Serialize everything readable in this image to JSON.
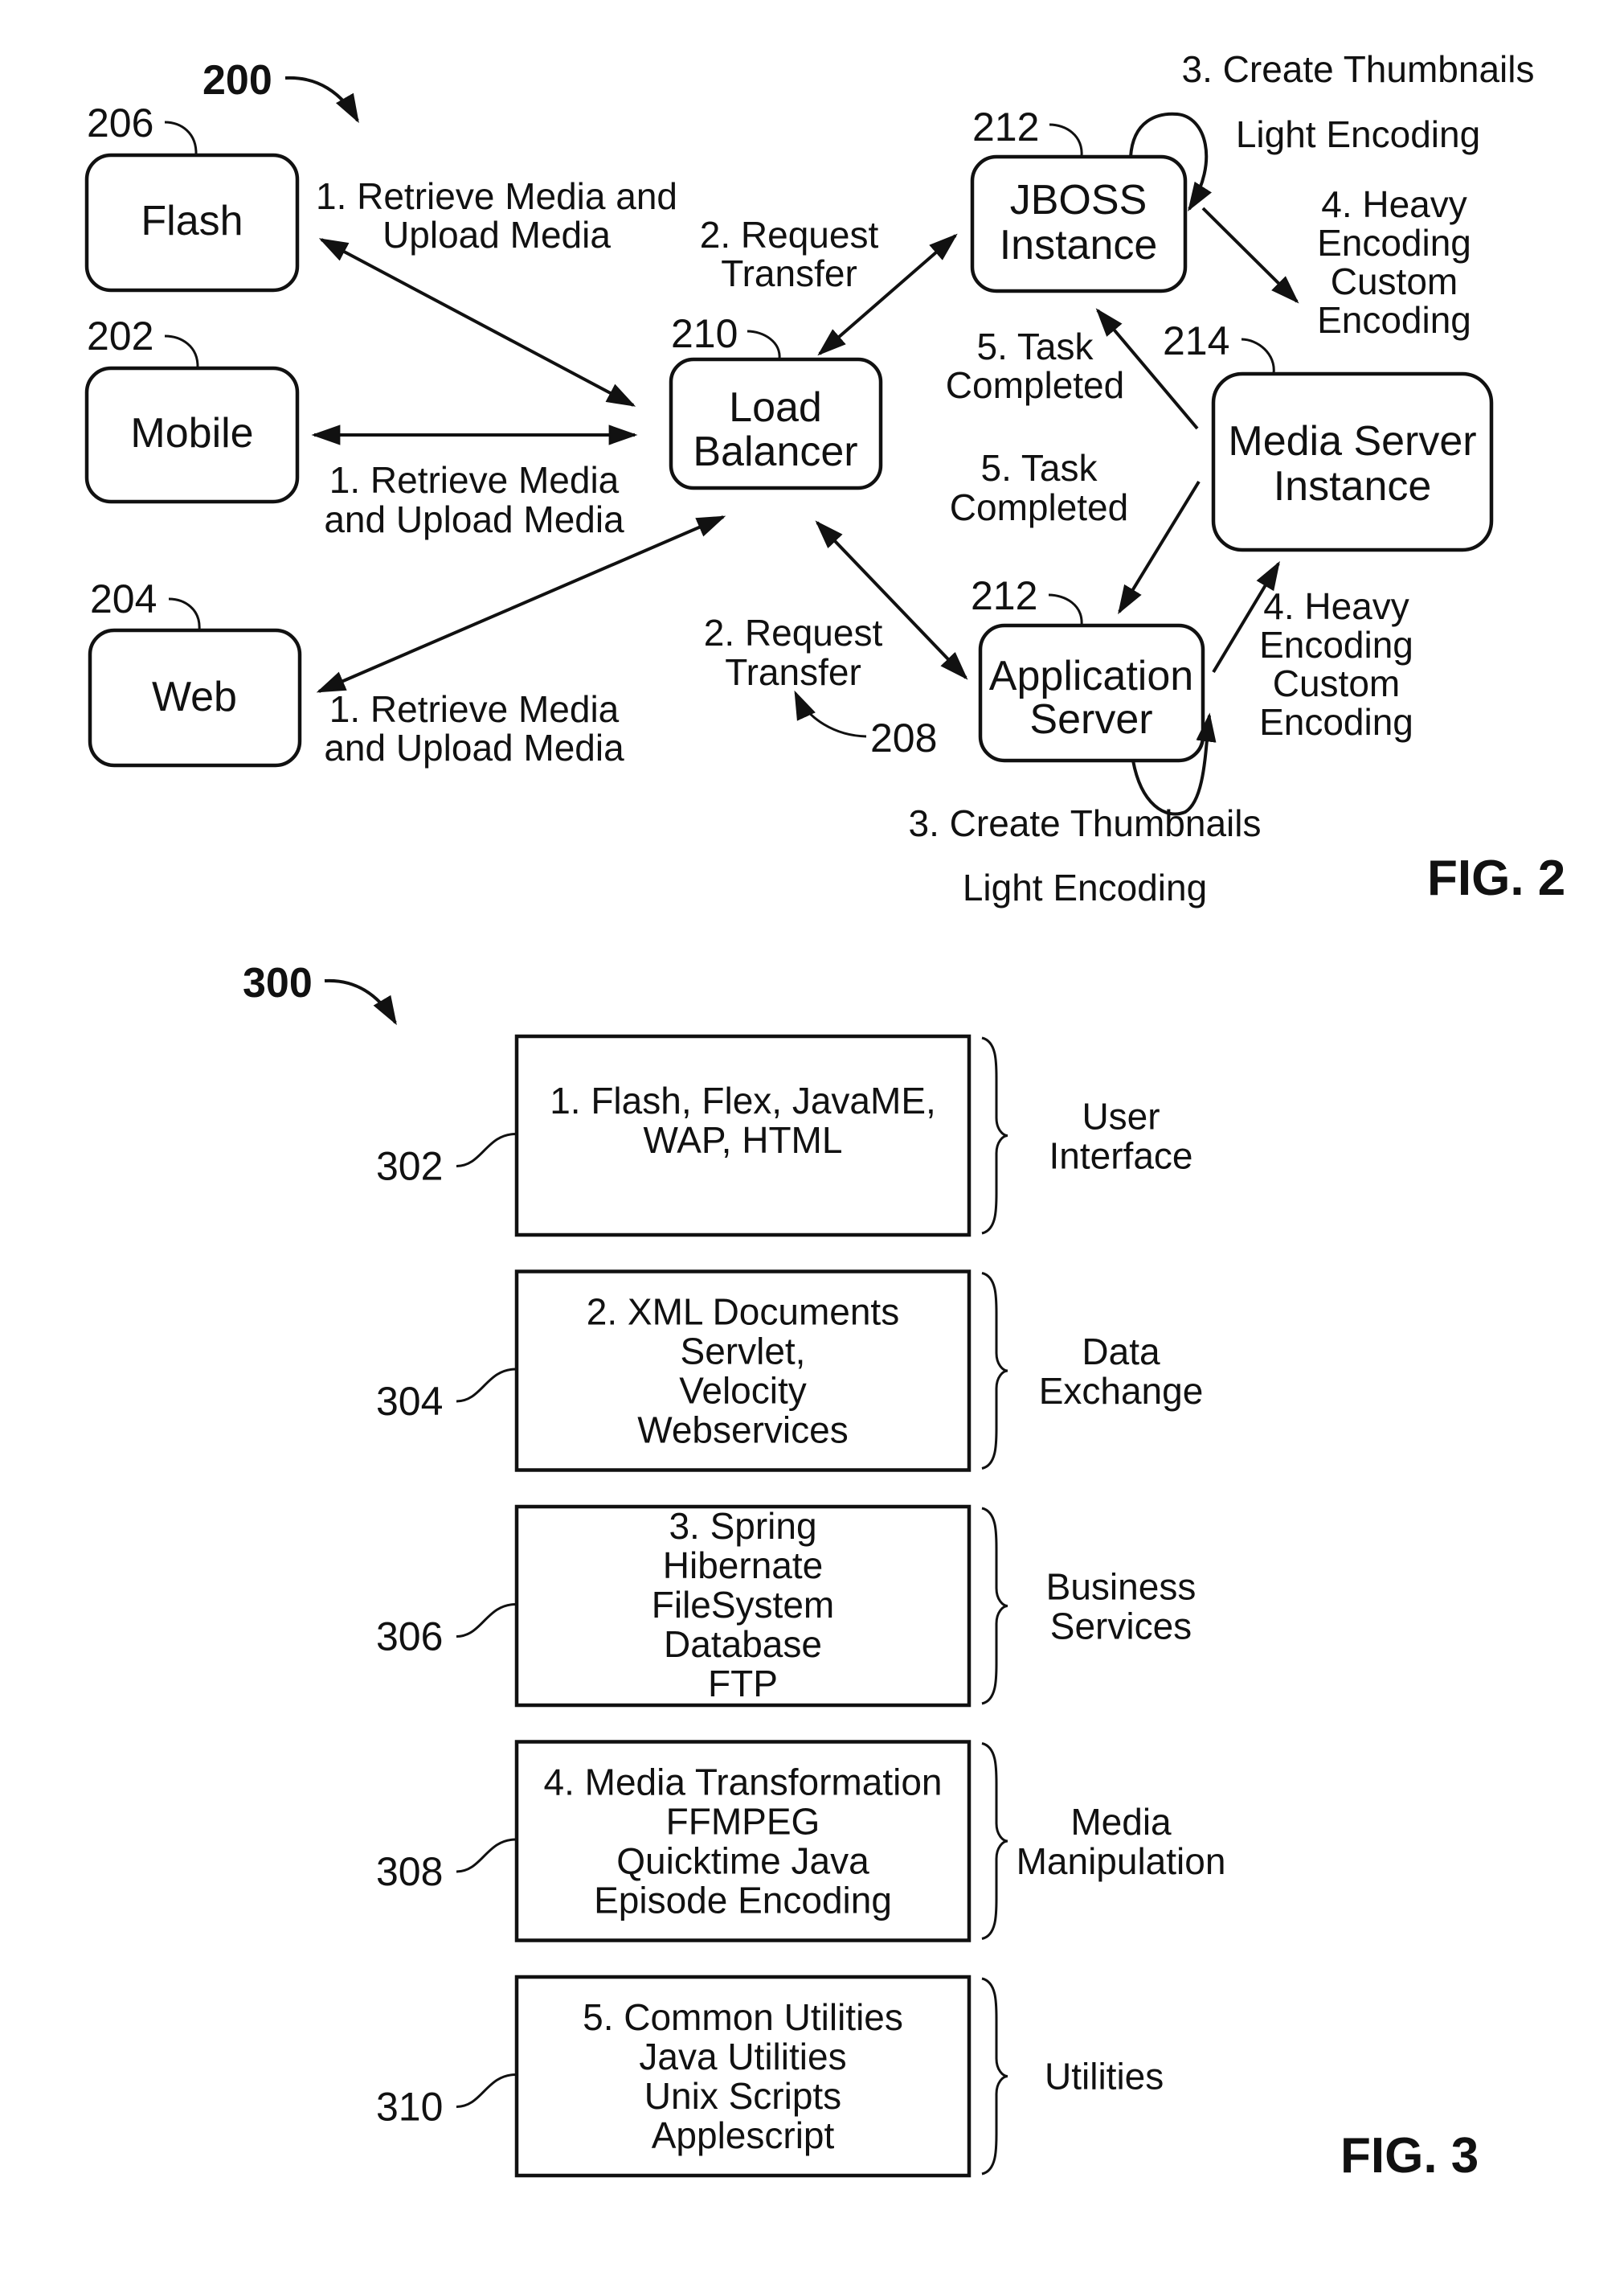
{
  "fig2": {
    "ref_number": "200",
    "figure_label": "FIG. 2",
    "nodes": {
      "flash": {
        "ref": "206",
        "label": [
          "Flash"
        ]
      },
      "mobile": {
        "ref": "202",
        "label": [
          "Mobile"
        ]
      },
      "web": {
        "ref": "204",
        "label": [
          "Web"
        ]
      },
      "load_balancer": {
        "ref": "210",
        "label": [
          "Load",
          "Balancer"
        ]
      },
      "jboss": {
        "ref": "212",
        "label": [
          "JBOSS",
          "Instance"
        ]
      },
      "media_server": {
        "ref": "214",
        "label": [
          "Media Server",
          "Instance"
        ]
      },
      "app_server": {
        "ref": "212",
        "label": [
          "Application",
          "Server"
        ]
      }
    },
    "edge_labels": {
      "flash_lb": [
        "1. Retrieve Media and",
        "Upload Media"
      ],
      "mobile_lb": [
        "1. Retrieve Media",
        "and Upload Media"
      ],
      "web_lb": [
        "1. Retrieve Media",
        "and Upload Media"
      ],
      "lb_jboss": [
        "2. Request",
        "Transfer"
      ],
      "lb_app": [
        "2. Request",
        "Transfer"
      ],
      "lb_app_ref": "208",
      "jboss_self": [
        "3. Create Thumbnails",
        "Light Encoding"
      ],
      "jboss_ms": [
        "4. Heavy",
        "Encoding",
        "Custom",
        "Encoding"
      ],
      "ms_jboss": [
        "5. Task",
        "Completed"
      ],
      "ms_app": [
        "5. Task",
        "Completed"
      ],
      "app_ms": [
        "4. Heavy",
        "Encoding",
        "Custom",
        "Encoding"
      ],
      "app_self": [
        "3. Create Thumbnails",
        "Light Encoding"
      ]
    }
  },
  "fig3": {
    "ref_number": "300",
    "figure_label": "FIG. 3",
    "layers": [
      {
        "ref": "302",
        "lines": [
          "1. Flash, Flex, JavaME,",
          "WAP, HTML"
        ],
        "category": [
          "User",
          "Interface"
        ]
      },
      {
        "ref": "304",
        "lines": [
          "2. XML Documents",
          "Servlet,",
          "Velocity",
          "Webservices"
        ],
        "category": [
          "Data",
          "Exchange"
        ]
      },
      {
        "ref": "306",
        "lines": [
          "3. Spring",
          "Hibernate",
          "FileSystem",
          "Database",
          "FTP"
        ],
        "category": [
          "Business",
          "Services"
        ]
      },
      {
        "ref": "308",
        "lines": [
          "4. Media Transformation",
          "FFMPEG",
          "Quicktime Java",
          "Episode Encoding"
        ],
        "category": [
          "Media",
          "Manipulation"
        ]
      },
      {
        "ref": "310",
        "lines": [
          "5. Common Utilities",
          "Java Utilities",
          "Unix Scripts",
          "Applescript"
        ],
        "category": [
          "Utilities"
        ]
      }
    ]
  }
}
